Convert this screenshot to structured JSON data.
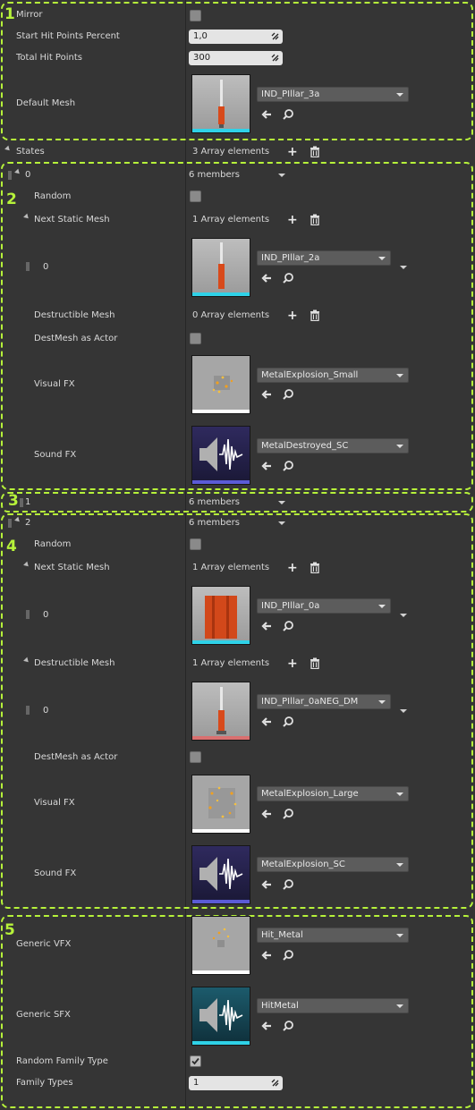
{
  "sections": [
    "1",
    "2",
    "3",
    "4",
    "5"
  ],
  "props": {
    "mirror": {
      "label": "Mirror",
      "checked": false
    },
    "start_hp": {
      "label": "Start Hit Points Percent",
      "value": "1,0"
    },
    "total_hp": {
      "label": "Total Hit Points",
      "value": "300"
    },
    "default_mesh": {
      "label": "Default Mesh",
      "asset": "IND_PIllar_3a"
    },
    "states": {
      "label": "States",
      "count": "3 Array elements"
    }
  },
  "state0": {
    "index": "0",
    "members": "6 members",
    "random": {
      "label": "Random"
    },
    "next_static_mesh": {
      "label": "Next Static Mesh",
      "count": "1 Array elements",
      "item_index": "0",
      "asset": "IND_PIllar_2a"
    },
    "destructible_mesh": {
      "label": "Destructible Mesh",
      "count": "0 Array elements"
    },
    "destmesh_as_actor": {
      "label": "DestMesh as Actor"
    },
    "visual_fx": {
      "label": "Visual FX",
      "asset": "MetalExplosion_Small"
    },
    "sound_fx": {
      "label": "Sound FX",
      "asset": "MetalDestroyed_SC"
    }
  },
  "state1": {
    "index": "1",
    "members": "6 members"
  },
  "state2": {
    "index": "2",
    "members": "6 members",
    "random": {
      "label": "Random"
    },
    "next_static_mesh": {
      "label": "Next Static Mesh",
      "count": "1 Array elements",
      "item_index": "0",
      "asset": "IND_PIllar_0a"
    },
    "destructible_mesh": {
      "label": "Destructible Mesh",
      "count": "1 Array elements",
      "item_index": "0",
      "asset": "IND_PIllar_0aNEG_DM"
    },
    "destmesh_as_actor": {
      "label": "DestMesh as Actor"
    },
    "visual_fx": {
      "label": "Visual FX",
      "asset": "MetalExplosion_Large"
    },
    "sound_fx": {
      "label": "Sound FX",
      "asset": "MetalExplosion_SC"
    }
  },
  "generic": {
    "vfx": {
      "label": "Generic VFX",
      "asset": "Hit_Metal"
    },
    "sfx": {
      "label": "Generic SFX",
      "asset": "HitMetal"
    },
    "random_family_type": {
      "label": "Random Family Type",
      "checked": true
    },
    "family_types": {
      "label": "Family Types",
      "value": "1"
    }
  },
  "colors": {
    "accent": "#b6f23a",
    "mesh_bar": "#2fd2e8",
    "fx_bar": "#ffffff",
    "sound_bar": "#5b5bd6",
    "dm_bar": "#d97070"
  }
}
